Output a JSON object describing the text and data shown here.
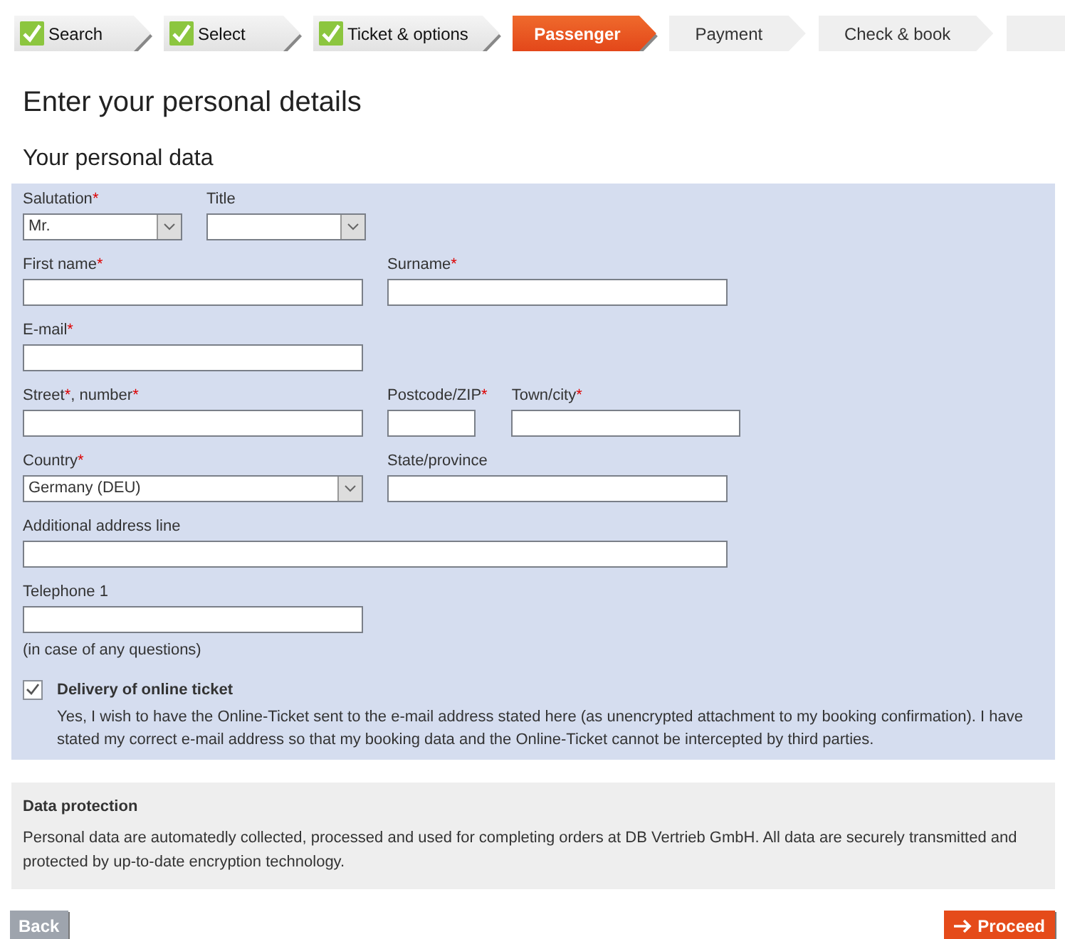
{
  "steps": [
    {
      "label": "Search",
      "done": true,
      "selected": false
    },
    {
      "label": "Select",
      "done": true,
      "selected": false
    },
    {
      "label": "Ticket & options",
      "done": true,
      "selected": false
    },
    {
      "label": "Passenger",
      "done": false,
      "selected": true
    },
    {
      "label": "Payment",
      "done": false,
      "selected": false
    },
    {
      "label": "Check & book",
      "done": false,
      "selected": false
    },
    {
      "done": false,
      "selected": false
    }
  ],
  "heading": "Enter your personal details",
  "section_title": "Your personal data",
  "rows": [
    [
      {
        "kind": "select",
        "label": [
          {
            "text": "Salutation"
          },
          {
            "text": "*",
            "kind": "asterisk"
          }
        ],
        "value": "Mr."
      },
      {
        "kind": "select",
        "label": [
          {
            "text": "Title"
          }
        ]
      }
    ],
    [
      {
        "kind": "text",
        "label": [
          {
            "text": "First name"
          },
          {
            "text": "*",
            "kind": "asterisk"
          }
        ]
      },
      {
        "kind": "text",
        "label": [
          {
            "text": "Surname"
          },
          {
            "text": "*",
            "kind": "asterisk"
          }
        ]
      }
    ],
    [
      {
        "kind": "text",
        "label": [
          {
            "text": "E-mail"
          },
          {
            "text": "*",
            "kind": "asterisk"
          }
        ]
      }
    ],
    [
      {
        "kind": "text",
        "label": [
          {
            "text": "Street"
          },
          {
            "text": "*",
            "kind": "asterisk"
          },
          {
            "text": ", number"
          },
          {
            "text": "*",
            "kind": "asterisk"
          }
        ]
      },
      {
        "kind": "text",
        "label": [
          {
            "text": "Postcode/ZIP"
          },
          {
            "text": "*",
            "kind": "asterisk"
          }
        ]
      },
      {
        "kind": "text",
        "label": [
          {
            "text": "Town/city"
          },
          {
            "text": "*",
            "kind": "asterisk"
          }
        ]
      }
    ],
    [
      {
        "kind": "select",
        "label": [
          {
            "text": "Country"
          },
          {
            "text": "*",
            "kind": "asterisk"
          }
        ],
        "value": "Germany (DEU)"
      },
      {
        "kind": "text",
        "label": [
          {
            "text": "State/province"
          }
        ]
      }
    ],
    [
      {
        "kind": "text",
        "label": [
          {
            "text": "Additional address line"
          }
        ]
      }
    ],
    [
      {
        "kind": "text",
        "label": [
          {
            "text": "Telephone 1"
          }
        ],
        "note": "(in case of any questions)"
      }
    ]
  ],
  "delivery": {
    "checked": true,
    "title": "Delivery of online ticket",
    "text": "Yes, I wish to have the Online-Ticket sent to the e-mail address stated here (as unencrypted attachment to my booking confirmation). I have stated my correct e-mail address so that my booking data and the Online-Ticket cannot be intercepted by third parties."
  },
  "data_protection": {
    "title": "Data protection",
    "text": "Personal data are automatedly collected, processed and used for completing orders at DB Vertrieb GmbH. All data are securely transmitted and protected by up-to-date encryption technology."
  },
  "back_button": "Back",
  "proceed_button": "Proceed"
}
